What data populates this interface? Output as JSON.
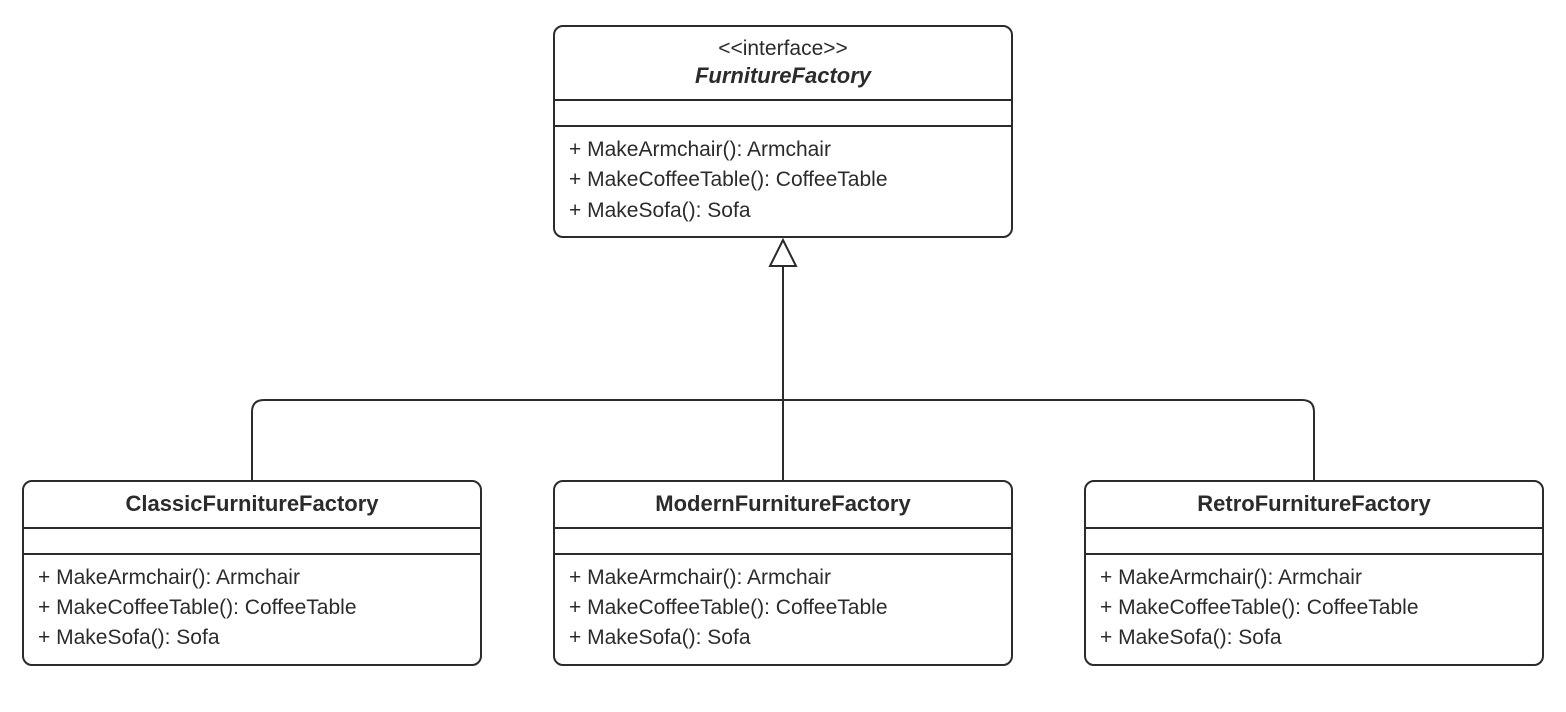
{
  "interface": {
    "stereotype": "<<interface>>",
    "name": "FurnitureFactory"
  },
  "ops": {
    "makeArmchair": "+ MakeArmchair(): Armchair",
    "makeCoffeeTable": "+ MakeCoffeeTable(): CoffeeTable",
    "makeSofa": "+ MakeSofa(): Sofa"
  },
  "subclasses": {
    "classic": {
      "name": "ClassicFurnitureFactory"
    },
    "modern": {
      "name": "ModernFurnitureFactory"
    },
    "retro": {
      "name": "RetroFurnitureFactory"
    }
  }
}
